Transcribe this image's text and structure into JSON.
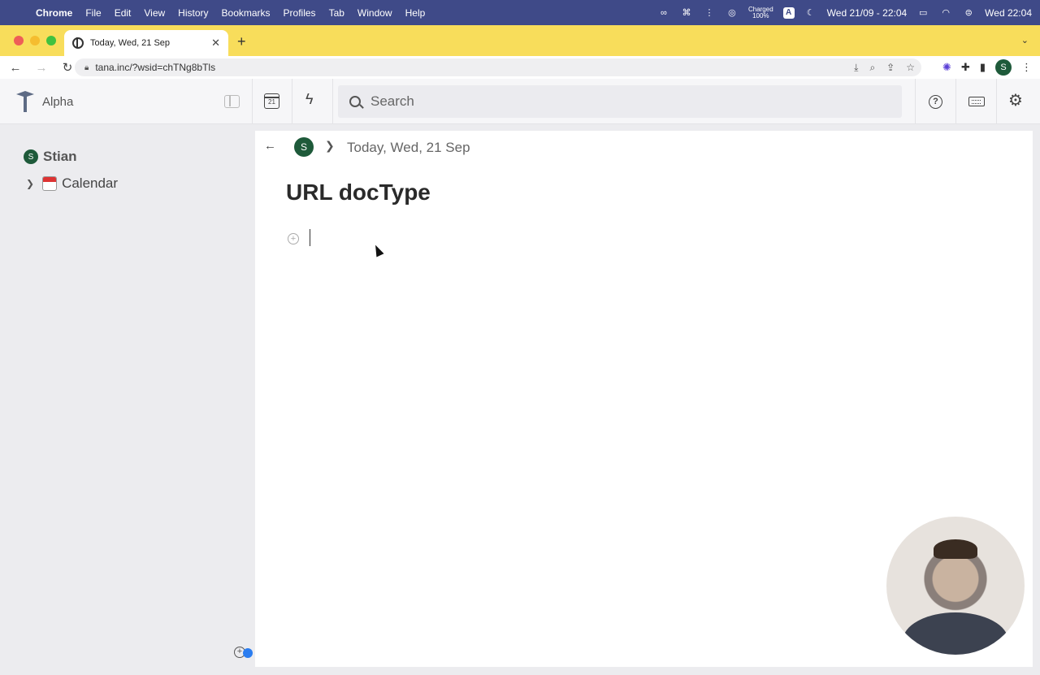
{
  "menubar": {
    "app": "Chrome",
    "items": [
      "File",
      "Edit",
      "View",
      "History",
      "Bookmarks",
      "Profiles",
      "Tab",
      "Window",
      "Help"
    ],
    "charged": "Charged",
    "battery": "100%",
    "input_badge": "A",
    "datetime": "Wed 21/09 - 22:04",
    "clock": "Wed 22:04"
  },
  "browser": {
    "tab_title": "Today, Wed, 21 Sep",
    "url": "tana.inc/?wsid=chTNg8bTls",
    "profile_initial": "S"
  },
  "app": {
    "workspace": "Alpha",
    "calendar_day": "21",
    "search_placeholder": "Search",
    "help_glyph": "?"
  },
  "sidebar": {
    "user_initial": "S",
    "user_name": "Stian",
    "items": [
      {
        "label": "Calendar"
      }
    ]
  },
  "main": {
    "breadcrumb_initial": "S",
    "breadcrumb": "Today, Wed, 21 Sep",
    "title": "URL docType"
  }
}
